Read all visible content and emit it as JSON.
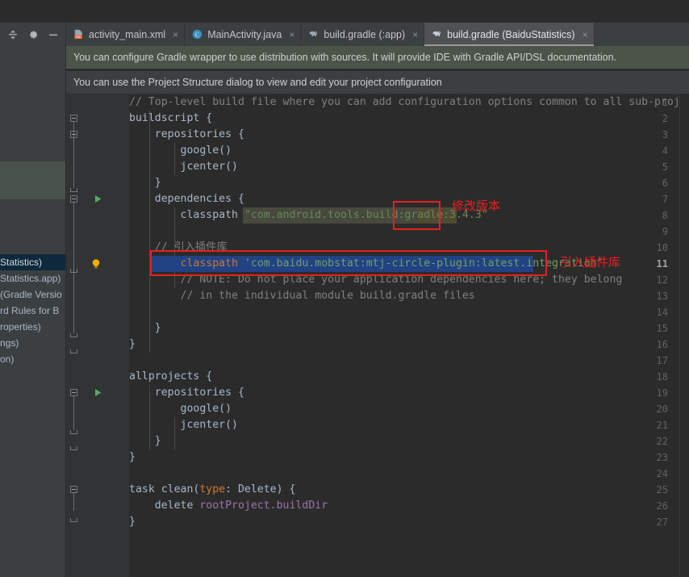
{
  "window": {
    "toolbar_icons": [
      {
        "name": "collapse-all-icon",
        "label": "Collapse All"
      },
      {
        "name": "settings-gear-icon",
        "label": "Settings"
      },
      {
        "name": "minimize-icon",
        "label": "Hide"
      }
    ]
  },
  "tabs": [
    {
      "label": "activity_main.xml",
      "icon": "android-xml-layout-icon",
      "active": false,
      "close": "×"
    },
    {
      "label": "MainActivity.java",
      "icon": "java-class-icon",
      "active": false,
      "close": "×"
    },
    {
      "label": "build.gradle (:app)",
      "icon": "gradle-elephant-icon",
      "active": false,
      "close": "×"
    },
    {
      "label": "build.gradle (BaiduStatistics)",
      "icon": "gradle-elephant-icon",
      "active": true,
      "close": "×"
    }
  ],
  "banners": [
    {
      "text": "You can configure Gradle wrapper to use distribution with sources. It will provide IDE with Gradle API/DSL documentation.",
      "color": "#4c5449"
    },
    {
      "text": "You can use the Project Structure dialog to view and edit your project configuration",
      "color": "#3c3f41"
    }
  ],
  "project_tree": [
    {
      "label": "Statistics)",
      "selected": true
    },
    {
      "label": "Statistics.app)",
      "selected": false
    },
    {
      "label": "(Gradle Versio",
      "selected": false
    },
    {
      "label": "rd Rules for B",
      "selected": false
    },
    {
      "label": "roperties)",
      "selected": false
    },
    {
      "label": "ngs)",
      "selected": false
    },
    {
      "label": "on)",
      "selected": false
    }
  ],
  "editor": {
    "file": "build.gradle (BaiduStatistics)",
    "current_line": 11,
    "lines": [
      {
        "n": 1,
        "text": "// Top-level build file where you can add configuration options common to all sub-projects/modules."
      },
      {
        "n": 2,
        "text": "buildscript {"
      },
      {
        "n": 3,
        "text": "    repositories {"
      },
      {
        "n": 4,
        "text": "        google()"
      },
      {
        "n": 5,
        "text": "        jcenter()"
      },
      {
        "n": 6,
        "text": "    }"
      },
      {
        "n": 7,
        "text": "    dependencies {"
      },
      {
        "n": 8,
        "text": "        classpath \"com.android.tools.build:gradle:3.4.3\""
      },
      {
        "n": 9,
        "text": ""
      },
      {
        "n": 10,
        "text": "    // 引入插件库"
      },
      {
        "n": 11,
        "text": "        classpath 'com.baidu.mobstat:mtj-circle-plugin:latest.integration'"
      },
      {
        "n": 12,
        "text": "        // NOTE: Do not place your application dependencies here; they belong"
      },
      {
        "n": 13,
        "text": "        // in the individual module build.gradle files"
      },
      {
        "n": 14,
        "text": ""
      },
      {
        "n": 15,
        "text": "    }"
      },
      {
        "n": 16,
        "text": "}"
      },
      {
        "n": 17,
        "text": ""
      },
      {
        "n": 18,
        "text": "allprojects {"
      },
      {
        "n": 19,
        "text": "    repositories {"
      },
      {
        "n": 20,
        "text": "        google()"
      },
      {
        "n": 21,
        "text": "        jcenter()"
      },
      {
        "n": 22,
        "text": "    }"
      },
      {
        "n": 23,
        "text": "}"
      },
      {
        "n": 24,
        "text": ""
      },
      {
        "n": 25,
        "text": "task clean(type: Delete) {"
      },
      {
        "n": 26,
        "text": "    delete rootProject.buildDir"
      },
      {
        "n": 27,
        "text": "}"
      }
    ]
  },
  "annotations": [
    {
      "text": "修改版本",
      "color": "#e8201f",
      "target": "gradle version 3.4.3"
    },
    {
      "text": "引入插件库",
      "color": "#e8201f",
      "target": "classpath baidu mtj-circle-plugin"
    }
  ],
  "colors": {
    "background": "#2b2b2b",
    "chrome": "#3c3f41",
    "gutter": "#313335",
    "selection": "#214283",
    "annotation_red": "#e8201f",
    "banner_green": "#4c5449",
    "comment": "#808080",
    "keyword": "#cc7832",
    "string": "#6a8759",
    "field": "#9876aa"
  }
}
